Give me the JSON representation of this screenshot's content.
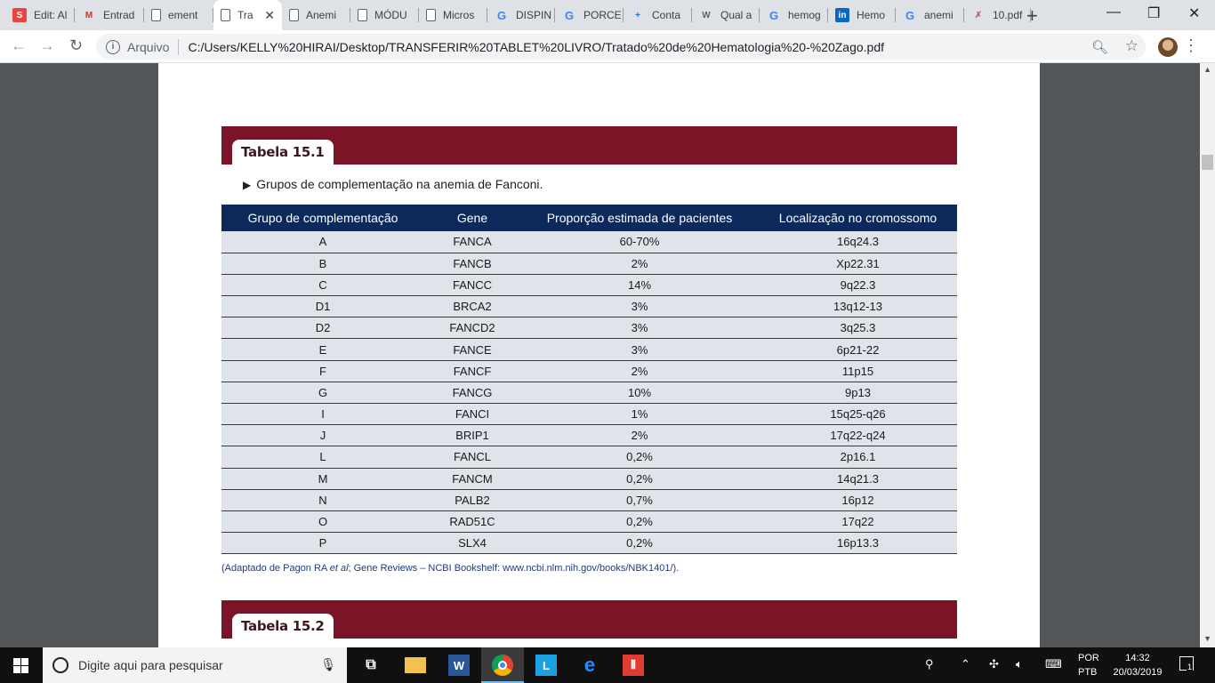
{
  "browser": {
    "tabs": [
      {
        "label": "Edit: Al",
        "favicon": "S",
        "favicon_color": "#e8453c"
      },
      {
        "label": "Entrad",
        "favicon": "M",
        "favicon_color": "#d93025"
      },
      {
        "label": "ement",
        "favicon": "doc"
      },
      {
        "label": "Tra",
        "favicon": "doc",
        "active": true,
        "close": "✕"
      },
      {
        "label": "Anemi",
        "favicon": "doc"
      },
      {
        "label": "MÓDU",
        "favicon": "doc"
      },
      {
        "label": "Micros",
        "favicon": "doc"
      },
      {
        "label": "DISPIN",
        "favicon": "G"
      },
      {
        "label": "PORCE",
        "favicon": "G"
      },
      {
        "label": "Conta",
        "favicon": "+",
        "favicon_color": "#1a73e8"
      },
      {
        "label": "Qual a",
        "favicon": "W",
        "favicon_color": "#5f6368"
      },
      {
        "label": "hemog",
        "favicon": "G"
      },
      {
        "label": "Hemo",
        "favicon": "in",
        "favicon_color": "#0a66c2"
      },
      {
        "label": "anemi",
        "favicon": "G"
      },
      {
        "label": "10.pdf",
        "favicon": "✗",
        "favicon_color": "#b06090"
      }
    ],
    "new_tab": "+",
    "minimize": "—",
    "restore": "❐",
    "close": "✕",
    "back": "←",
    "forward": "→",
    "reload": "↻",
    "scheme_label": "Arquivo",
    "url": "C:/Users/KELLY%20HIRAI/Desktop/TRANSFERIR%20TABLET%20LIVRO/Tratado%20de%20Hematologia%20-%20Zago.pdf"
  },
  "document": {
    "table1": {
      "label": "Tabela 15.1",
      "caption": "Grupos de complementação na anemia de Fanconi.",
      "headers": [
        "Grupo de complementação",
        "Gene",
        "Proporção estimada de pacientes",
        "Localização no cromossomo"
      ],
      "rows": [
        [
          "A",
          "FANCA",
          "60-70%",
          "16q24.3"
        ],
        [
          "B",
          "FANCB",
          "2%",
          "Xp22.31"
        ],
        [
          "C",
          "FANCC",
          "14%",
          "9q22.3"
        ],
        [
          "D1",
          "BRCA2",
          "3%",
          "13q12-13"
        ],
        [
          "D2",
          "FANCD2",
          "3%",
          "3q25.3"
        ],
        [
          "E",
          "FANCE",
          "3%",
          "6p21-22"
        ],
        [
          "F",
          "FANCF",
          "2%",
          "11p15"
        ],
        [
          "G",
          "FANCG",
          "10%",
          "9p13"
        ],
        [
          "I",
          "FANCI",
          "1%",
          "15q25-q26"
        ],
        [
          "J",
          "BRIP1",
          "2%",
          "17q22-q24"
        ],
        [
          "L",
          "FANCL",
          "0,2%",
          "2p16.1"
        ],
        [
          "M",
          "FANCM",
          "0,2%",
          "14q21.3"
        ],
        [
          "N",
          "PALB2",
          "0,7%",
          "16p12"
        ],
        [
          "O",
          "RAD51C",
          "0,2%",
          "17q22"
        ],
        [
          "P",
          "SLX4",
          "0,2%",
          "16p13.3"
        ]
      ],
      "source_prefix": "(Adaptado de Pagon RA ",
      "source_em": "et al",
      "source_suffix": "; Gene Reviews – NCBI Bookshelf: www.ncbi.nlm.nih.gov/books/NBK1401/)."
    },
    "table2": {
      "label": "Tabela 15.2"
    },
    "colors": {
      "banner": "#7b1427",
      "header": "#0b2a5b",
      "row": "#dfe3ea"
    }
  },
  "taskbar": {
    "search_placeholder": "Digite aqui para pesquisar",
    "language": "POR",
    "layout": "PTB",
    "time": "14:32",
    "date": "20/03/2019",
    "notifications": "1"
  }
}
